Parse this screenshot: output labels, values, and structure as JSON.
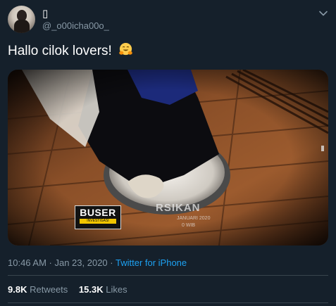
{
  "author": {
    "display_name": "▯",
    "handle": "@_o00icha00o_"
  },
  "tweet": {
    "text": "Hallo cilok lovers!",
    "emoji": "hugging-face-emoji"
  },
  "media": {
    "badge_main": "BUSER",
    "badge_sub": "INVESTIGASI",
    "overlay_line_1": "RSIKAN",
    "overlay_line_2": "JANUARI 2020",
    "overlay_line_3": "0 WIB"
  },
  "meta": {
    "time_date": "10:46 AM · Jan 23, 2020 · ",
    "source": "Twitter for iPhone"
  },
  "stats": {
    "retweets_count": "9.8K",
    "retweets_label": "Retweets",
    "likes_count": "15.3K",
    "likes_label": "Likes"
  },
  "colors": {
    "background": "#15202b",
    "secondary_text": "#8899a6",
    "link": "#1da1f2",
    "divider": "#38444d"
  }
}
